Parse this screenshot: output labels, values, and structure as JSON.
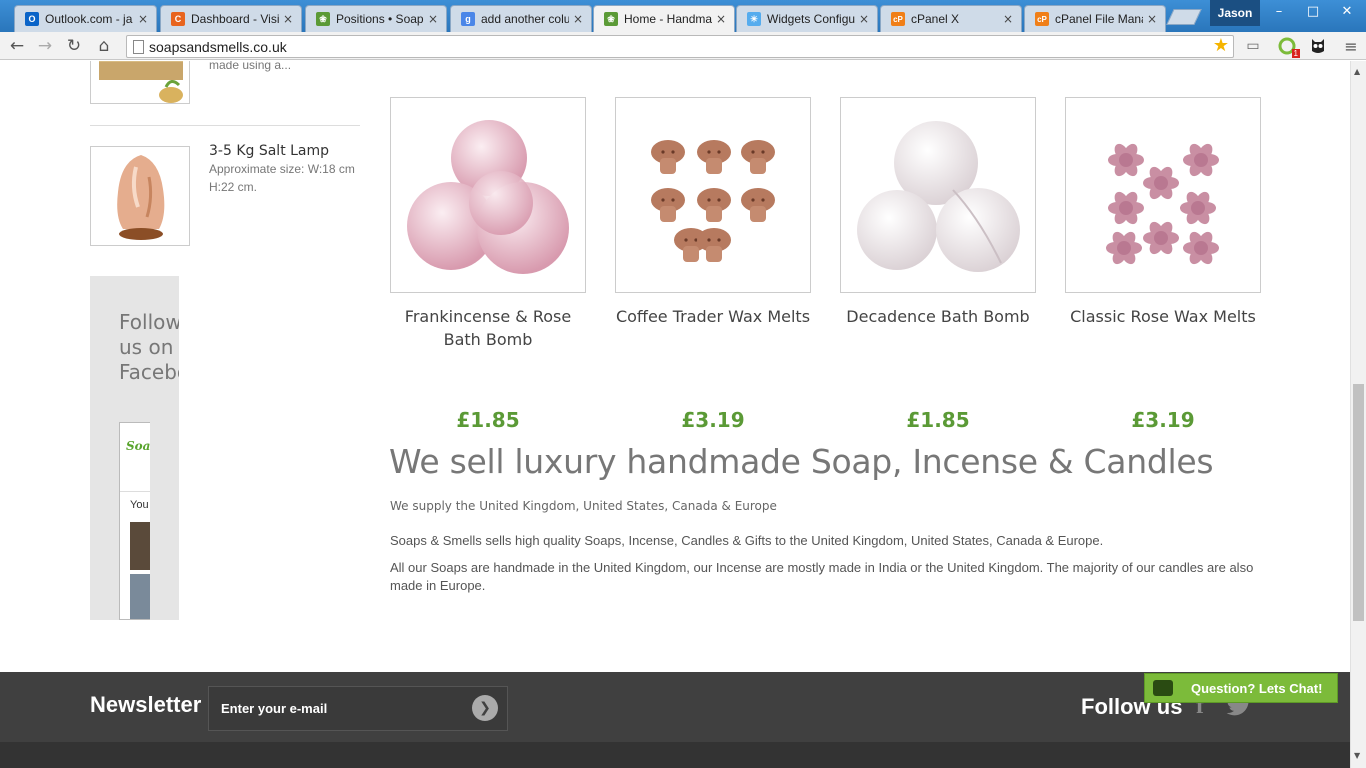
{
  "browser": {
    "tabs": [
      {
        "label": "Outlook.com - ja",
        "favicon_color": "#0a64c8",
        "favicon_letter": "O"
      },
      {
        "label": "Dashboard - Visi",
        "favicon_color": "#e8641e",
        "favicon_letter": "C"
      },
      {
        "label": "Positions • Soap",
        "favicon_color": "#5b9a36",
        "favicon_letter": "❀"
      },
      {
        "label": "add another colu",
        "favicon_color": "#4a86e8",
        "favicon_letter": "g"
      },
      {
        "label": "Home - Handma",
        "favicon_color": "#5b9a36",
        "favicon_letter": "❀"
      },
      {
        "label": "Widgets Configu",
        "favicon_color": "#55acee",
        "favicon_letter": "☀"
      },
      {
        "label": "cPanel X",
        "favicon_color": "#f07f18",
        "favicon_letter": "cP"
      },
      {
        "label": "cPanel File Mana",
        "favicon_color": "#f07f18",
        "favicon_letter": "cP"
      }
    ],
    "close_glyph": "×",
    "user": "Jason",
    "url": "soapsandsmells.co.uk",
    "extension_badge": "1"
  },
  "sidebar": {
    "items": [
      {
        "title": "",
        "desc": "made using a..."
      },
      {
        "title": "3-5 Kg Salt Lamp",
        "desc": "Approximate size: W:18 cm H:22 cm."
      }
    ],
    "facebook": {
      "title": "Follow us on Facebook",
      "logo": "Soaps & Smells",
      "you": "You"
    }
  },
  "products": [
    {
      "name": "Frankincense & Rose Bath Bomb",
      "price": "£1.85"
    },
    {
      "name": "Coffee Trader Wax Melts",
      "price": "£3.19"
    },
    {
      "name": "Decadence Bath Bomb",
      "price": "£1.85"
    },
    {
      "name": "Classic Rose Wax Melts",
      "price": "£3.19"
    }
  ],
  "main": {
    "headline": "We sell luxury handmade Soap, Incense & Candles",
    "subline": "We supply the United Kingdom, United States, Canada & Europe",
    "para1": "Soaps & Smells sells high quality Soaps, Incense, Candles & Gifts to the United Kingdom, United States, Canada & Europe.",
    "para2": "All our Soaps are handmade in the United Kingdom, our Incense are mostly made in India or the United Kingdom. The majority of our candles are also made in Europe."
  },
  "footer": {
    "newsletter_label": "Newsletter",
    "email_placeholder": "Enter your e-mail",
    "follow_label": "Follow us"
  },
  "chat": {
    "label": "Question? Lets Chat!"
  },
  "colors": {
    "price_green": "#5b9a36",
    "footer_bg": "#404040",
    "chat_green": "#7cbb3a"
  },
  "icons": [
    "back-icon",
    "forward-icon",
    "reload-icon",
    "home-icon",
    "star-icon",
    "cast-icon",
    "facebook-icon",
    "twitter-icon",
    "chat-bubble-icon",
    "arrow-right-icon"
  ]
}
